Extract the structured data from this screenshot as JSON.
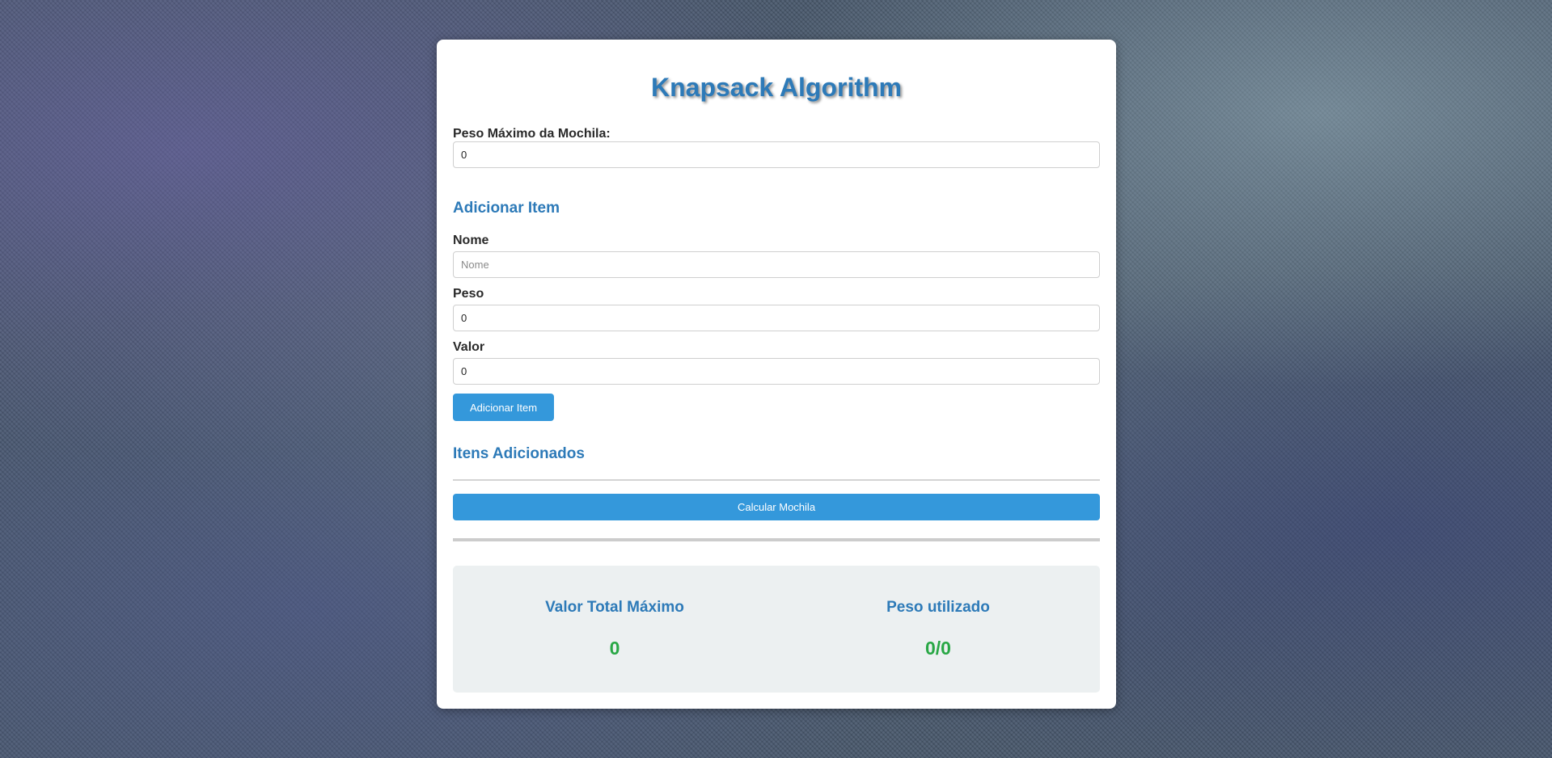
{
  "app": {
    "title": "Knapsack Algorithm"
  },
  "capacity": {
    "label": "Peso Máximo da Mochila:",
    "value": "0"
  },
  "add_item": {
    "heading": "Adicionar Item",
    "name_label": "Nome",
    "name_placeholder": "Nome",
    "name_value": "",
    "weight_label": "Peso",
    "weight_value": "0",
    "value_label": "Valor",
    "value_value": "0",
    "button_label": "Adicionar Item"
  },
  "items": {
    "heading": "Itens Adicionados",
    "list": []
  },
  "calculate": {
    "button_label": "Calcular Mochila"
  },
  "results": {
    "total_value_label": "Valor Total Máximo",
    "total_value": "0",
    "weight_used_label": "Peso utilizado",
    "weight_used": "0/0"
  },
  "colors": {
    "accent": "#3498db",
    "heading": "#2d7ab8",
    "result_value": "#28a745",
    "results_background": "#ecf0f1"
  }
}
